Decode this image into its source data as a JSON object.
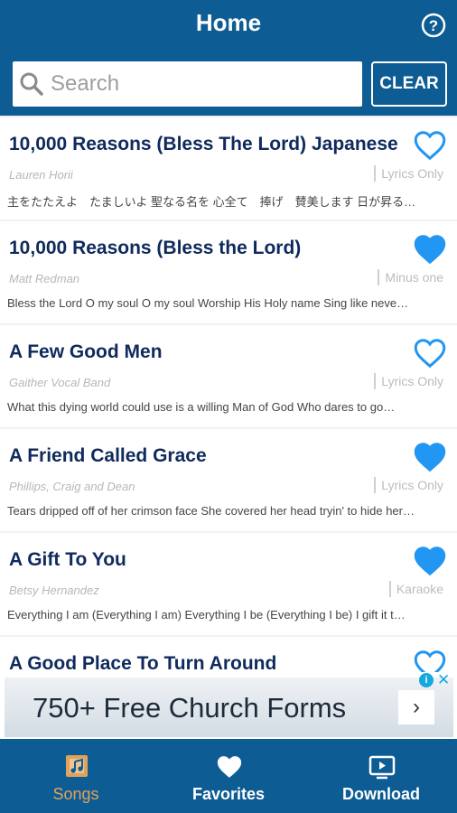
{
  "header": {
    "title": "Home",
    "help_icon": "help-circle-icon",
    "search_placeholder": "Search",
    "search_value": "",
    "clear_label": "CLEAR"
  },
  "songs": [
    {
      "title": "10,000 Reasons (Bless The Lord) Japanese",
      "artist": "Lauren Horii",
      "tag": "Lyrics Only",
      "preview": "主をたたえよ　たましいよ 聖なる名を 心全て　捧げ　賛美します 日が昇る…",
      "favorite": false
    },
    {
      "title": "10,000 Reasons (Bless the Lord)",
      "artist": "Matt Redman",
      "tag": "Minus one",
      "preview": "Bless the Lord O my soul   O my soul   Worship His Holy name   Sing like neve…",
      "favorite": true
    },
    {
      "title": "A Few Good Men",
      "artist": "Gaither Vocal Band",
      "tag": "Lyrics Only",
      "preview": "What this dying world could use is a willing Man of God   Who dares to go…",
      "favorite": false
    },
    {
      "title": "A Friend Called Grace",
      "artist": "Phillips, Craig and Dean",
      "tag": "Lyrics Only",
      "preview": "Tears dripped off of her crimson face  She covered her head tryin' to hide her…",
      "favorite": true
    },
    {
      "title": "A Gift To You",
      "artist": "Betsy Hernandez",
      "tag": "Karaoke",
      "preview": "Everything I am   (Everything I am)   Everything I be   (Everything I be)   I gift it t…",
      "favorite": true
    },
    {
      "title": "A Good Place To Turn Around",
      "artist": "",
      "tag": "",
      "preview": "",
      "favorite": false
    }
  ],
  "ad": {
    "text": "750+ Free Church Forms",
    "arrow": "›",
    "info": "i",
    "close": "✕"
  },
  "nav": {
    "songs": {
      "label": "Songs",
      "icon": "music-note-icon"
    },
    "favorites": {
      "label": "Favorites",
      "icon": "heart-icon"
    },
    "download": {
      "label": "Download",
      "icon": "tv-download-icon"
    }
  },
  "colors": {
    "primary": "#0d5c94",
    "accent_active": "#e0a35c",
    "heart": "#2196f3",
    "title_text": "#0f2a5c"
  }
}
